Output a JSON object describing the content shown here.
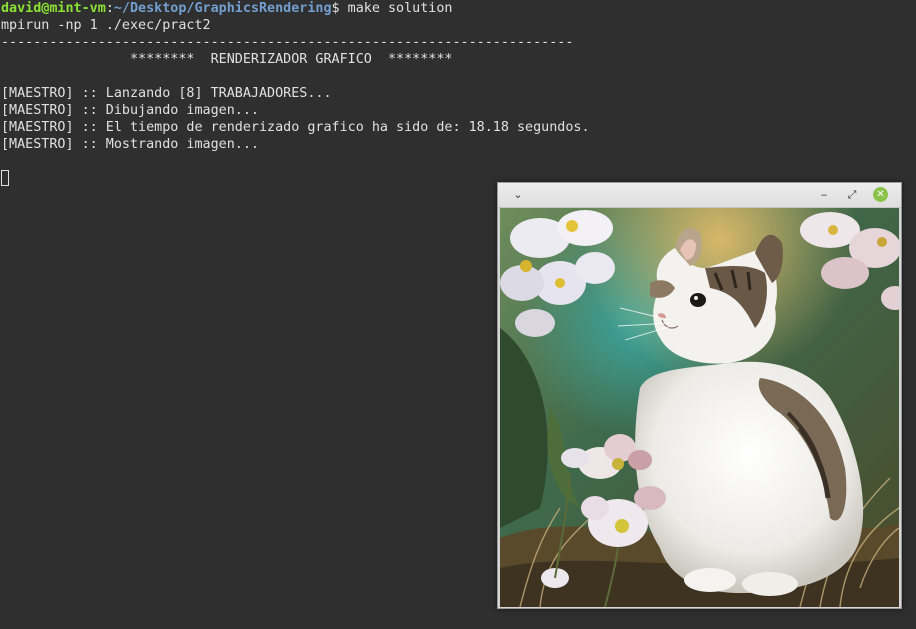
{
  "terminal": {
    "prompt": {
      "user_host": "david@mint-vm",
      "separator": ":",
      "path": "~/Desktop/GraphicsRendering",
      "sign": "$",
      "command": " make solution"
    },
    "lines": [
      "mpirun -np 1 ./exec/pract2",
      "-----------------------------------------------------------------------",
      "                ********  RENDERIZADOR GRAFICO  ********",
      "",
      "[MAESTRO] :: Lanzando [8] TRABAJADORES...",
      "[MAESTRO] :: Dibujando imagen...",
      "[MAESTRO] :: El tiempo de renderizado grafico ha sido de: 18.18 segundos.",
      "[MAESTRO] :: Mostrando imagen..."
    ]
  },
  "viewer": {
    "menu_icon": "chevron-down-icon",
    "menu_glyph": "⌄",
    "minimize_glyph": "‒",
    "maximize_glyph": "⤢",
    "close_glyph": "✕",
    "image": "kitten-among-flowers"
  },
  "colors": {
    "terminal_bg": "#2f2f2f",
    "prompt_user": "#8ae234",
    "prompt_path": "#729fcf",
    "close_button": "#8bc34a"
  }
}
